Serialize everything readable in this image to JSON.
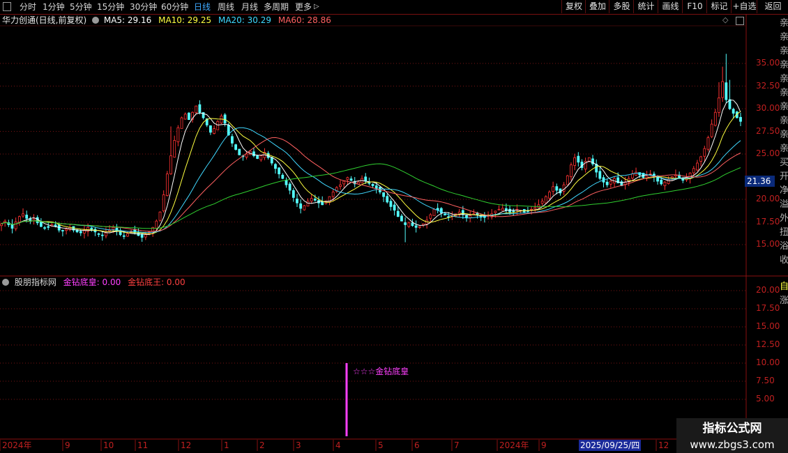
{
  "toolbar": {
    "periods": [
      "分时",
      "1分钟",
      "5分钟",
      "15分钟",
      "30分钟",
      "60分钟",
      "日线",
      "周线",
      "月线",
      "多周期",
      "更多"
    ],
    "active_period": "日线",
    "more_arrow": "▷",
    "buttons": [
      "复权",
      "叠加",
      "多股",
      "统计",
      "画线",
      "F10",
      "标记",
      "+自选",
      "返回"
    ]
  },
  "main_chart": {
    "stock_title": "华力创通(日线,前复权)",
    "ma": [
      {
        "label": "MA5: 29.16",
        "color": "#ffffff"
      },
      {
        "label": "MA10: 29.25",
        "color": "#ffff40"
      },
      {
        "label": "MA20: 30.29",
        "color": "#40d8ff"
      },
      {
        "label": "MA60: 28.86",
        "color": "#ff6060"
      }
    ],
    "y_ticks": [
      "35.00",
      "32.50",
      "30.00",
      "27.50",
      "25.00",
      "20.00",
      "17.50",
      "15.00"
    ],
    "last_price_tag": "21.36",
    "right_edge_chars": [
      "亲",
      "亲",
      "亲",
      "亲",
      "亲",
      "亲",
      "亲",
      "亲",
      "亲",
      "亲",
      "买",
      "开",
      "净",
      "溢",
      "外",
      "扭",
      "浴",
      "收"
    ]
  },
  "indicator": {
    "name": "股朋指标网",
    "params": [
      {
        "label": "金钻底皇: 0.00",
        "color": "#ff40ff"
      },
      {
        "label": "金钻底王: 0.00",
        "color": "#ff4040"
      }
    ],
    "y_ticks": [
      "20.00",
      "17.50",
      "15.00",
      "12.50",
      "10.00",
      "7.50",
      "5.00"
    ],
    "signal_text": "☆☆☆金钻底皇",
    "right_edge_chars": [
      "自",
      "涨"
    ]
  },
  "x_axis": {
    "labels": [
      "2024年",
      "9",
      "10",
      "11",
      "12",
      "1",
      "2",
      "3",
      "4",
      "5",
      "6",
      "7",
      "2024年",
      "9",
      "2025/09/25/四",
      "12"
    ],
    "highlight_date": "2025/09/25/四"
  },
  "watermark": {
    "line1": "指标公式网",
    "line2": "www.zbgs3.com"
  },
  "chart_data": {
    "type": "candlestick",
    "ylim": [
      13,
      38
    ],
    "ma_legend": [
      "MA5",
      "MA10",
      "MA20",
      "MA60"
    ],
    "close_series": [
      17.3,
      17.6,
      17.2,
      16.8,
      17.5,
      18.1,
      18.4,
      17.9,
      17.6,
      17.8,
      17.4,
      17.0,
      16.8,
      16.9,
      17.2,
      17.0,
      16.6,
      16.5,
      16.7,
      16.9,
      16.6,
      16.4,
      16.3,
      16.6,
      16.9,
      16.7,
      16.4,
      16.2,
      16.0,
      16.3,
      16.6,
      16.9,
      16.5,
      16.1,
      15.9,
      16.2,
      16.5,
      16.3,
      16.0,
      15.8,
      16.1,
      16.4,
      16.9,
      17.6,
      18.6,
      20.5,
      22.8,
      24.8,
      26.5,
      27.9,
      29.0,
      29.4,
      28.8,
      29.6,
      30.3,
      29.6,
      29.0,
      28.2,
      27.4,
      27.8,
      28.6,
      29.2,
      28.4,
      27.1,
      26.2,
      25.5,
      24.9,
      24.7,
      25.0,
      25.3,
      24.8,
      24.5,
      24.8,
      25.2,
      24.6,
      24.0,
      23.4,
      22.8,
      22.3,
      21.6,
      21.0,
      20.2,
      19.6,
      19.0,
      19.3,
      19.8,
      20.1,
      19.9,
      19.6,
      19.4,
      19.8,
      20.3,
      20.8,
      21.3,
      21.6,
      22.0,
      22.4,
      22.1,
      21.7,
      21.9,
      22.3,
      22.0,
      21.8,
      21.5,
      21.2,
      20.8,
      20.3,
      19.7,
      19.2,
      18.8,
      18.1,
      17.6,
      17.2,
      17.4,
      17.1,
      16.9,
      17.0,
      17.3,
      17.7,
      18.3,
      18.9,
      18.8,
      18.5,
      18.3,
      18.1,
      18.2,
      18.4,
      18.6,
      18.3,
      18.0,
      18.2,
      18.4,
      18.3,
      18.1,
      18.0,
      18.2,
      18.4,
      18.7,
      18.9,
      19.0,
      18.8,
      18.6,
      18.7,
      18.9,
      18.8,
      18.6,
      18.7,
      18.9,
      19.1,
      19.4,
      19.8,
      20.3,
      20.8,
      21.4,
      21.0,
      20.7,
      21.6,
      22.6,
      23.8,
      24.6,
      24.1,
      23.5,
      24.2,
      24.6,
      23.9,
      23.0,
      22.3,
      21.9,
      21.6,
      22.0,
      22.3,
      21.8,
      21.5,
      21.9,
      22.3,
      22.8,
      23.0,
      22.7,
      22.4,
      22.6,
      22.8,
      22.5,
      22.0,
      21.7,
      21.9,
      22.2,
      22.5,
      22.7,
      22.4,
      22.1,
      22.4,
      22.9,
      23.4,
      24.0,
      24.7,
      25.6,
      26.8,
      28.3,
      29.6,
      31.2,
      33.0,
      31.0,
      30.0,
      29.5,
      29.0,
      28.6
    ]
  }
}
